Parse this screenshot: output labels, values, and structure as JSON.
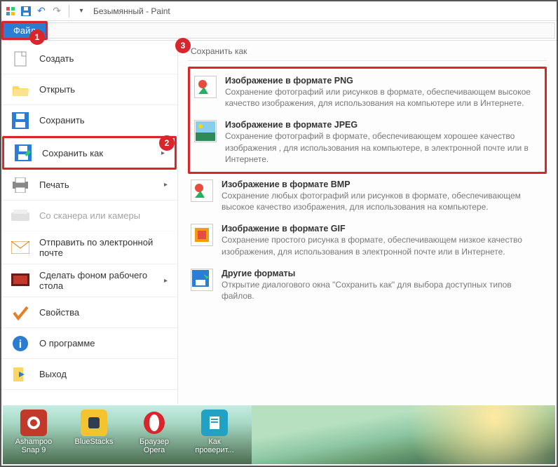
{
  "title": "Безымянный - Paint",
  "file_tab": "Файл",
  "callouts": {
    "c1": "1",
    "c2": "2",
    "c3": "3"
  },
  "menu": {
    "create": "Создать",
    "open": "Открыть",
    "save": "Сохранить",
    "saveas": "Сохранить как",
    "print": "Печать",
    "scanner": "Со сканера или камеры",
    "email": "Отправить по электронной почте",
    "desktop": "Сделать фоном рабочего стола",
    "properties": "Свойства",
    "about": "О программе",
    "exit": "Выход"
  },
  "saveas_panel": {
    "header": "Сохранить как",
    "png": {
      "title": "Изображение в формате PNG",
      "desc": "Сохранение фотографий или рисунков в формате, обеспечивающем высокое качество изображения, для использования на компьютере или в Интернете."
    },
    "jpeg": {
      "title": "Изображение в формате JPEG",
      "desc": "Сохранение фотографий в формате, обеспечивающем хорошее качество изображения , для использования на компьютере, в электронной почте или в Интернете."
    },
    "bmp": {
      "title": "Изображение в формате BMP",
      "desc": "Сохранение любых фотографий или рисунков в формате, обеспечивающем высокое качество изображения, для использования на компьютере."
    },
    "gif": {
      "title": "Изображение в формате GIF",
      "desc": "Сохранение простого рисунка в формате, обеспечивающем низкое качество изображения, для использования в электронной почте или в Интернете."
    },
    "other": {
      "title": "Другие форматы",
      "desc": "Открытие диалогового окна \"Сохранить как\" для выбора доступных типов файлов."
    }
  },
  "taskbar": [
    {
      "label": "Ashampoo Snap 9"
    },
    {
      "label": "BlueStacks"
    },
    {
      "label": "Браузер Opera"
    },
    {
      "label": "Как проверит..."
    }
  ]
}
